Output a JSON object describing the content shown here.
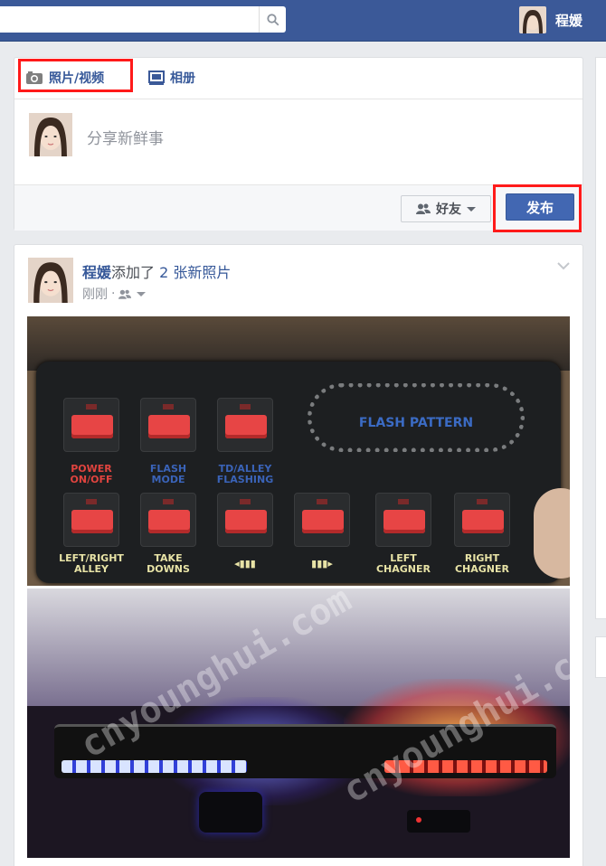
{
  "topbar": {
    "search_placeholder": "",
    "user_name": "程媛"
  },
  "composer": {
    "tab_photo_label": "照片/视频",
    "tab_album_label": "相册",
    "placeholder": "分享新鲜事",
    "audience_label": "好友",
    "post_label": "发布"
  },
  "story": {
    "actor": "程媛",
    "action": "添加了",
    "object": "2 张新照片",
    "time": "刚刚",
    "photo1": {
      "flash_pattern": "FLASH PATTERN",
      "keys_top": [
        {
          "label": "POWER\nON/OFF",
          "color": "red"
        },
        {
          "label": "FLASH\nMODE",
          "color": "blue"
        },
        {
          "label": "TD/ALLEY\nFLASHING",
          "color": "blue"
        }
      ],
      "keys_bottom": [
        {
          "label": "LEFT/RIGHT\nALLEY"
        },
        {
          "label": "TAKE\nDOWNS"
        },
        {
          "label": "◂▮▮▮"
        },
        {
          "label": "▮▮▮▸"
        },
        {
          "label": "LEFT\nCHAGNER"
        },
        {
          "label": "RIGHT\nCHAGNER"
        }
      ]
    },
    "photo2": {
      "watermark": "cnyounghui.com"
    }
  },
  "colors": {
    "brand": "#3b5998",
    "link": "#365899",
    "post_button": "#4267b2",
    "highlight": "#ff1a1a"
  },
  "icons": [
    "search-icon",
    "camera-icon",
    "album-icon",
    "friends-icon",
    "chevron-down-icon"
  ]
}
